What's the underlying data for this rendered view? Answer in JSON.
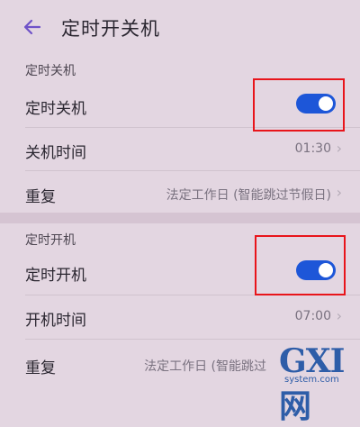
{
  "header": {
    "title": "定时开关机"
  },
  "shutdown": {
    "section": "定时关机",
    "toggle_label": "定时关机",
    "time_label": "关机时间",
    "time_value": "01:30",
    "repeat_label": "重复",
    "repeat_value": "法定工作日 (智能跳过节假日)"
  },
  "startup": {
    "section": "定时开机",
    "toggle_label": "定时开机",
    "time_label": "开机时间",
    "time_value": "07:00",
    "repeat_label": "重复",
    "repeat_value": "法定工作日 (智能跳过"
  },
  "colors": {
    "accent": "#1d56d8",
    "highlight": "#e8151b"
  },
  "watermark": {
    "brand": "GXI网",
    "site": "system.com"
  }
}
